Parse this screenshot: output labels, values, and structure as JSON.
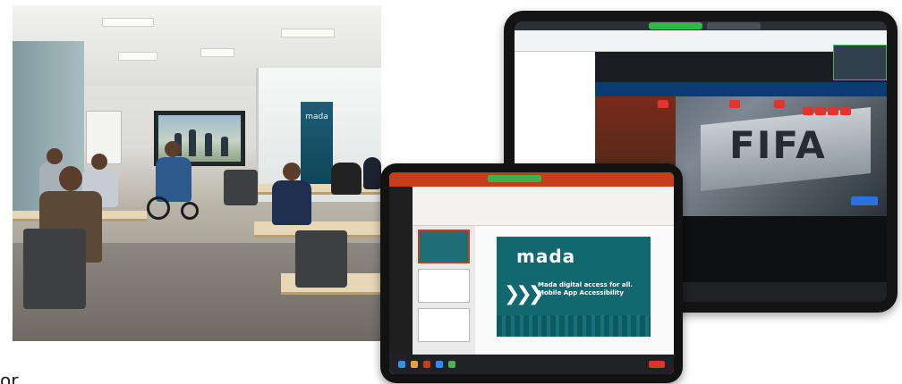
{
  "caption": "or",
  "classroom": {
    "banner_text": "mada"
  },
  "fifa_screen": {
    "sign_text": "FIFA"
  },
  "ppt_slide": {
    "logo_text": "mada",
    "headline": "Mada digital access for all. Mobile App Accessibility"
  }
}
